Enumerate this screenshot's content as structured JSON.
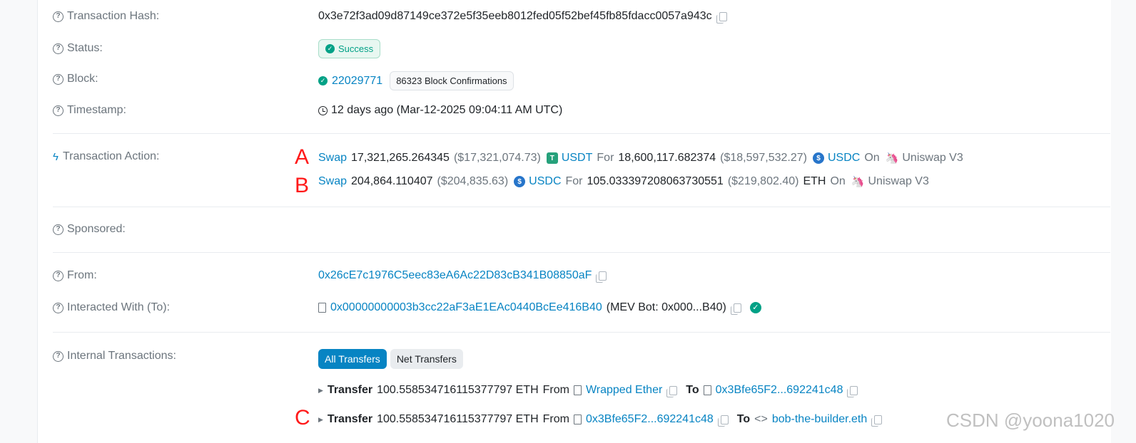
{
  "hash": {
    "label": "Transaction Hash:",
    "value": "0x3e72f3ad09d87149ce372e5f35eeb8012fed05f52bef45fb85fdacc0057a943c"
  },
  "status": {
    "label": "Status:",
    "value": "Success"
  },
  "block": {
    "label": "Block:",
    "number": "22029771",
    "confirmations": "86323 Block Confirmations"
  },
  "timestamp": {
    "label": "Timestamp:",
    "value": "12 days ago (Mar-12-2025 09:04:11 AM UTC)"
  },
  "action": {
    "label": "Transaction Action:",
    "swaps": [
      {
        "marker": "A",
        "verb": "Swap",
        "amount_in": "17,321,265.264345",
        "usd_in": "($17,321,074.73)",
        "token_in": "USDT",
        "for": "For",
        "amount_out": "18,600,117.682374",
        "usd_out": "($18,597,532.27)",
        "token_out": "USDC",
        "on": "On",
        "dex": "Uniswap V3"
      },
      {
        "marker": "B",
        "verb": "Swap",
        "amount_in": "204,864.110407",
        "usd_in": "($204,835.63)",
        "token_in": "USDC",
        "for": "For",
        "amount_out": "105.033397208063730551",
        "usd_out": "($219,802.40)",
        "token_out": "ETH",
        "on": "On",
        "dex": "Uniswap V3"
      }
    ]
  },
  "sponsored": {
    "label": "Sponsored:"
  },
  "from": {
    "label": "From:",
    "address": "0x26cE7c1976C5eec83eA6Ac22D83cB341B08850aF"
  },
  "to": {
    "label": "Interacted With (To):",
    "address": "0x00000000003b3cc22aF3aE1EAc0440BcEe416B40",
    "tag": "(MEV Bot: 0x000...B40)"
  },
  "internal": {
    "label": "Internal Transactions:",
    "tabs": [
      "All Transfers",
      "Net Transfers"
    ],
    "transfers": [
      {
        "marker": "",
        "kind": "Transfer",
        "amount": "100.558534716115377797 ETH",
        "from_word": "From",
        "from": "Wrapped Ether",
        "to_word": "To",
        "to": "0x3Bfe65F2...692241c48"
      },
      {
        "marker": "C",
        "kind": "Transfer",
        "amount": "100.558534716115377797 ETH",
        "from_word": "From",
        "from": "0x3Bfe65F2...692241c48",
        "to_word": "To",
        "to": "bob-the-builder.eth"
      }
    ]
  },
  "watermark": "CSDN @yoona1020"
}
